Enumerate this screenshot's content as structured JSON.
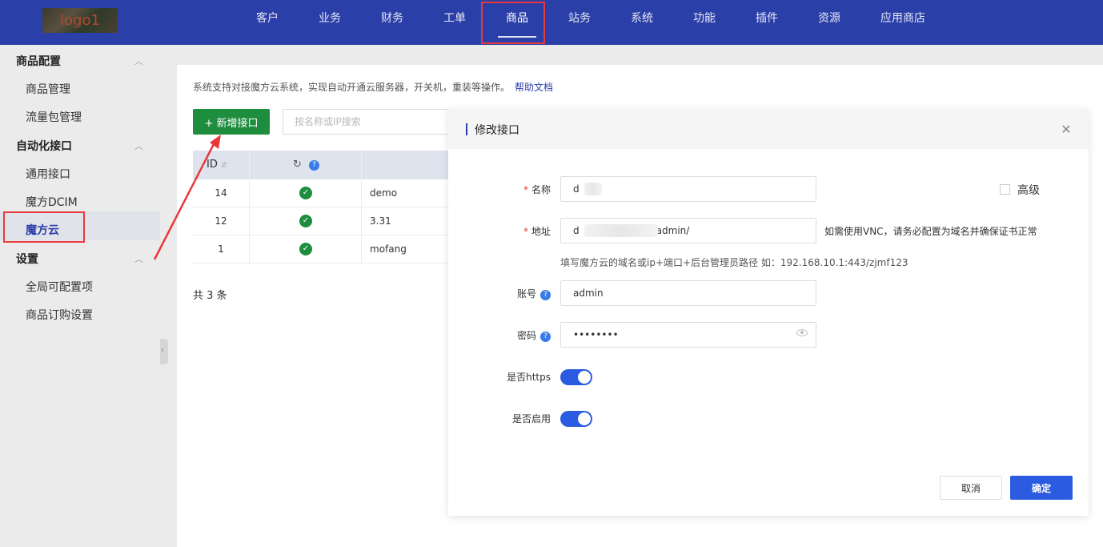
{
  "logo_text": "logo1",
  "nav": {
    "items": [
      "客户",
      "业务",
      "财务",
      "工单",
      "商品",
      "站务",
      "系统",
      "功能",
      "插件",
      "资源",
      "应用商店"
    ],
    "active": "商品"
  },
  "sidebar": {
    "groups": [
      {
        "title": "商品配置",
        "items": [
          "商品管理",
          "流量包管理"
        ]
      },
      {
        "title": "自动化接口",
        "items": [
          "通用接口",
          "魔方DCIM",
          "魔方云"
        ]
      },
      {
        "title": "设置",
        "items": [
          "全局可配置项",
          "商品订购设置"
        ]
      }
    ],
    "active_item": "魔方云"
  },
  "main": {
    "description": "系统支持对接魔方云系统，实现自动开通云服务器，开关机，重装等操作。",
    "help_link": "帮助文档",
    "add_button": "+ 新增接口",
    "search_placeholder": "按名称或IP搜索",
    "table": {
      "headers": [
        "ID",
        "",
        ""
      ],
      "rows": [
        {
          "id": "14",
          "status": "ok",
          "name": "demo"
        },
        {
          "id": "12",
          "status": "ok",
          "name": "3.31"
        },
        {
          "id": "1",
          "status": "ok",
          "name": "mofang"
        }
      ]
    },
    "total": "共 3 条"
  },
  "dialog": {
    "title": "修改接口",
    "fields": {
      "name": {
        "label": "名称",
        "value": "d"
      },
      "address": {
        "label": "地址",
        "value_prefix": "d",
        "value_suffix": "/admin/"
      },
      "account": {
        "label": "账号",
        "value": "admin"
      },
      "password": {
        "label": "密码",
        "value": "••••••••"
      },
      "https": {
        "label": "是否https",
        "on": true
      },
      "enabled": {
        "label": "是否启用",
        "on": true
      }
    },
    "address_hint_right": "如需使用VNC，请务必配置为域名并确保证书正常",
    "address_hint_below": "填写魔方云的域名或ip+端口+后台管理员路径 如：192.168.10.1:443/zjmf123",
    "advanced_label": "高级",
    "cancel_label": "取消",
    "confirm_label": "确定"
  },
  "colors": {
    "topbar": "#2b3fa8",
    "primary": "#2b5be0",
    "success": "#1e8d3e",
    "annotation_red": "#e8393a"
  }
}
